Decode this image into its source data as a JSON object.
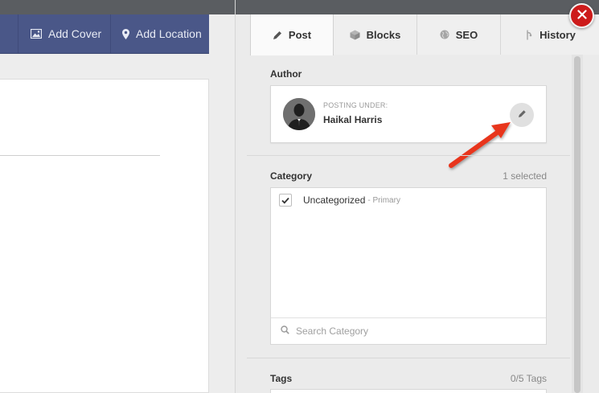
{
  "toolbar": {
    "add_cover": "Add Cover",
    "add_location": "Add Location"
  },
  "tabs": [
    {
      "label": "Post",
      "icon": "pencil-icon",
      "active": true
    },
    {
      "label": "Blocks",
      "icon": "cube-icon",
      "active": false
    },
    {
      "label": "SEO",
      "icon": "globe-icon",
      "active": false
    },
    {
      "label": "History",
      "icon": "history-icon",
      "active": false
    }
  ],
  "author": {
    "title": "Author",
    "posting_under": "POSTING UNDER:",
    "name": "Haikal Harris"
  },
  "category": {
    "title": "Category",
    "selected_count": "1 selected",
    "items": [
      {
        "name": "Uncategorized",
        "primary_label": "- Primary",
        "checked": true
      }
    ],
    "search_placeholder": "Search Category"
  },
  "tags": {
    "title": "Tags",
    "count": "0/5 Tags"
  },
  "colors": {
    "toolbar": "#4a5788",
    "close": "#cd1b1b",
    "arrow": "#e8341c"
  }
}
